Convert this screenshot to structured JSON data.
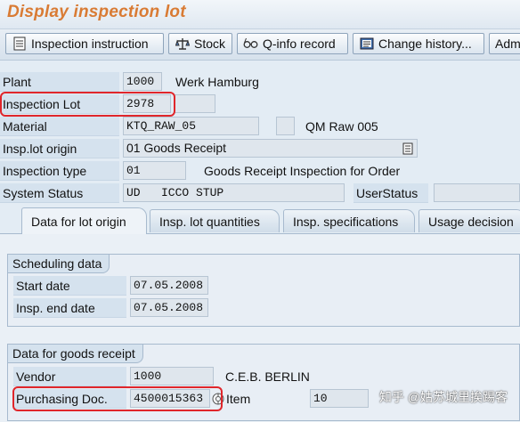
{
  "window": {
    "title": "Display inspection lot"
  },
  "toolbar": [
    {
      "label": "Inspection instruction",
      "icon": "list-doc-icon"
    },
    {
      "label": "Stock",
      "icon": "balance-icon"
    },
    {
      "label": "Q-info record",
      "icon": "glasses-icon"
    },
    {
      "label": "Change history...",
      "icon": "history-icon"
    },
    {
      "label": "Adm"
    }
  ],
  "header": {
    "plant": {
      "label": "Plant",
      "value": "1000",
      "text": "Werk Hamburg"
    },
    "inspection_lot": {
      "label": "Inspection Lot",
      "value": "2978"
    },
    "material": {
      "label": "Material",
      "value": "KTQ_RAW_05",
      "text": "QM Raw 005"
    },
    "insp_lot_origin": {
      "label": "Insp.lot origin",
      "value": "01 Goods Receipt"
    },
    "inspection_type": {
      "label": "Inspection type",
      "value": "01",
      "text": "Goods Receipt Inspection for Order"
    },
    "system_status": {
      "label": "System Status",
      "value": "UD   ICCO STUP",
      "user_status_label": "UserStatus"
    }
  },
  "tabs": [
    {
      "label": "Data for lot origin",
      "active": true
    },
    {
      "label": "Insp. lot quantities",
      "active": false
    },
    {
      "label": "Insp. specifications",
      "active": false
    },
    {
      "label": "Usage decision",
      "active": false
    }
  ],
  "scheduling": {
    "title": "Scheduling data",
    "start_date": {
      "label": "Start date",
      "value": "07.05.2008"
    },
    "insp_end_date": {
      "label": "Insp. end date",
      "value": "07.05.2008"
    }
  },
  "goods_receipt": {
    "title": "Data for goods receipt",
    "vendor": {
      "label": "Vendor",
      "value": "1000",
      "text": "C.E.B. BERLIN"
    },
    "purchasing_doc": {
      "label": "Purchasing Doc.",
      "value": "4500015363",
      "item_label": "Item",
      "item_value": "10"
    }
  },
  "watermark": "知乎 @姑苏城里挨踢客",
  "colors": {
    "title": "#d97b34",
    "highlight": "#e0262b"
  }
}
